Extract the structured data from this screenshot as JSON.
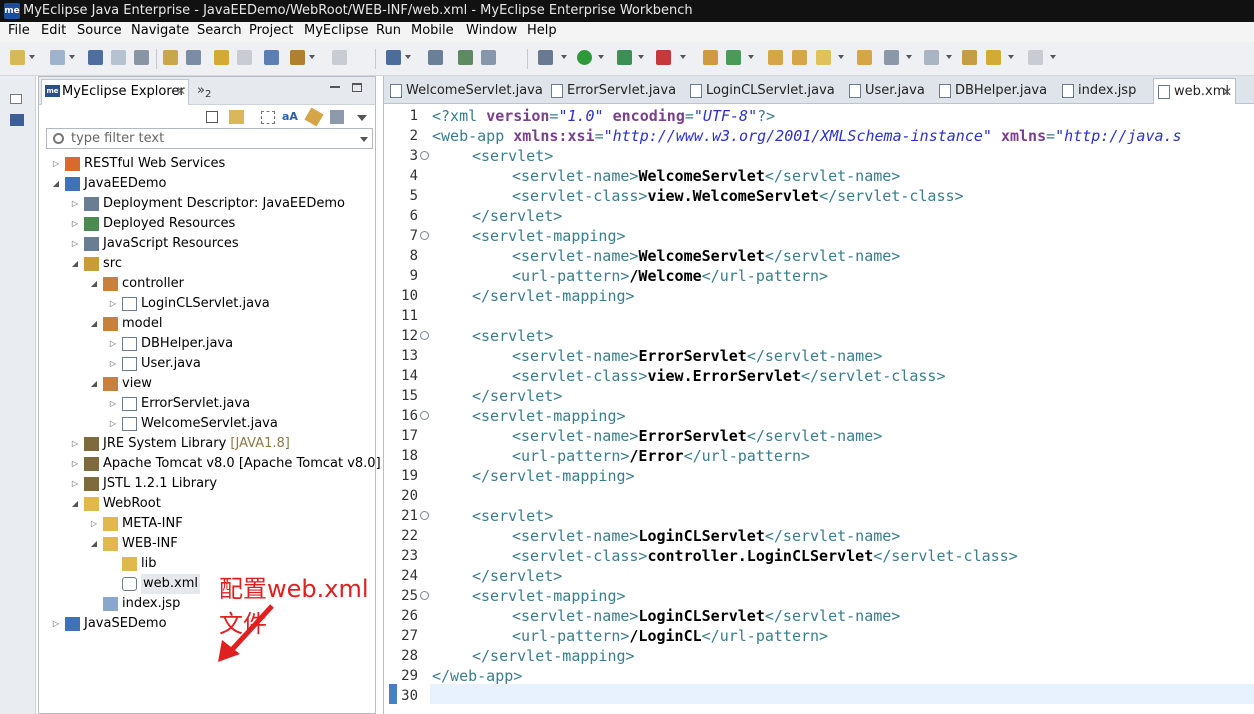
{
  "window": {
    "title": "MyEclipse Java Enterprise - JavaEEDemo/WebRoot/WEB-INF/web.xml - MyEclipse Enterprise Workbench"
  },
  "menu": [
    "File",
    "Edit",
    "Source",
    "Navigate",
    "Search",
    "Project",
    "MyEclipse",
    "Run",
    "Mobile",
    "Window",
    "Help"
  ],
  "explorer": {
    "tab_label": "MyEclipse Explorer",
    "tab_close": "✕",
    "overflow_count": "2",
    "filter_placeholder": "type filter text",
    "tree": [
      {
        "label": "RESTful Web Services",
        "icon": "rest-icon"
      },
      {
        "label": "JavaEEDemo",
        "icon": "project-icon"
      },
      {
        "label": "Deployment Descriptor: JavaEEDemo",
        "icon": "descriptor-icon"
      },
      {
        "label": "Deployed Resources",
        "icon": "deployed-icon"
      },
      {
        "label": "JavaScript Resources",
        "icon": "js-icon"
      },
      {
        "label": "src",
        "icon": "source-folder-icon"
      },
      {
        "label": "controller",
        "icon": "package-icon"
      },
      {
        "label": "LoginCLServlet.java",
        "icon": "java-file-icon"
      },
      {
        "label": "model",
        "icon": "package-icon"
      },
      {
        "label": "DBHelper.java",
        "icon": "java-file-icon"
      },
      {
        "label": "User.java",
        "icon": "java-file-icon"
      },
      {
        "label": "view",
        "icon": "package-icon"
      },
      {
        "label": "ErrorServlet.java",
        "icon": "java-file-icon"
      },
      {
        "label": "WelcomeServlet.java",
        "icon": "java-file-icon"
      },
      {
        "label": "JRE System Library",
        "suffix": "[JAVA1.8]",
        "icon": "library-icon"
      },
      {
        "label": "Apache Tomcat v8.0 [Apache Tomcat v8.0]",
        "icon": "library-icon"
      },
      {
        "label": "JSTL 1.2.1 Library",
        "icon": "library-icon"
      },
      {
        "label": "WebRoot",
        "icon": "folder-icon"
      },
      {
        "label": "META-INF",
        "icon": "folder-icon"
      },
      {
        "label": "WEB-INF",
        "icon": "folder-icon"
      },
      {
        "label": "lib",
        "icon": "folder-icon"
      },
      {
        "label": "web.xml",
        "icon": "xml-file-icon"
      },
      {
        "label": "index.jsp",
        "icon": "jsp-file-icon"
      },
      {
        "label": "JavaSEDemo",
        "icon": "project-icon"
      }
    ]
  },
  "annotation": "配置web.xml文件",
  "editor": {
    "tabs": [
      "WelcomeServlet.java",
      "ErrorServlet.java",
      "LoginCLServlet.java",
      "User.java",
      "DBHelper.java",
      "index.jsp",
      "web.xml"
    ],
    "active_tab": "web.xml",
    "tab_close": "✕",
    "lines": [
      "1",
      "2",
      "3",
      "4",
      "5",
      "6",
      "7",
      "8",
      "9",
      "10",
      "11",
      "12",
      "13",
      "14",
      "15",
      "16",
      "17",
      "18",
      "19",
      "20",
      "21",
      "22",
      "23",
      "24",
      "25",
      "26",
      "27",
      "28",
      "29",
      "30"
    ],
    "code": {
      "l1": {
        "a": "<?xml ",
        "b": "version",
        "c": "=",
        "d": "\"1.0\"",
        "e": " encoding",
        "f": "=",
        "g": "\"UTF-8\"",
        "h": "?>"
      },
      "l2": {
        "a": "<web-app ",
        "b": "xmlns:xsi",
        "c": "=",
        "d": "\"http://www.w3.org/2001/XMLSchema-instance\"",
        "e": " xmlns",
        "f": "=",
        "g": "\"http://java.s"
      },
      "servlet_open": "<servlet>",
      "servlet_close": "</servlet>",
      "mapping_open": "<servlet-mapping>",
      "mapping_close": "</servlet-mapping>",
      "name_open": "<servlet-name>",
      "name_close": "</servlet-name>",
      "class_open": "<servlet-class>",
      "class_close": "</servlet-class>",
      "url_open": "<url-pattern>",
      "url_close": "</url-pattern>",
      "webapp_close": "</web-app>",
      "welcome_name": "WelcomeServlet",
      "welcome_class": "view.WelcomeServlet",
      "welcome_url": "/Welcome",
      "error_name": "ErrorServlet",
      "error_class": "view.ErrorServlet",
      "error_url": "/Error",
      "login_name": "LoginCLServlet",
      "login_class": "controller.LoginCLServlet",
      "login_url": "/LoginCL"
    }
  }
}
